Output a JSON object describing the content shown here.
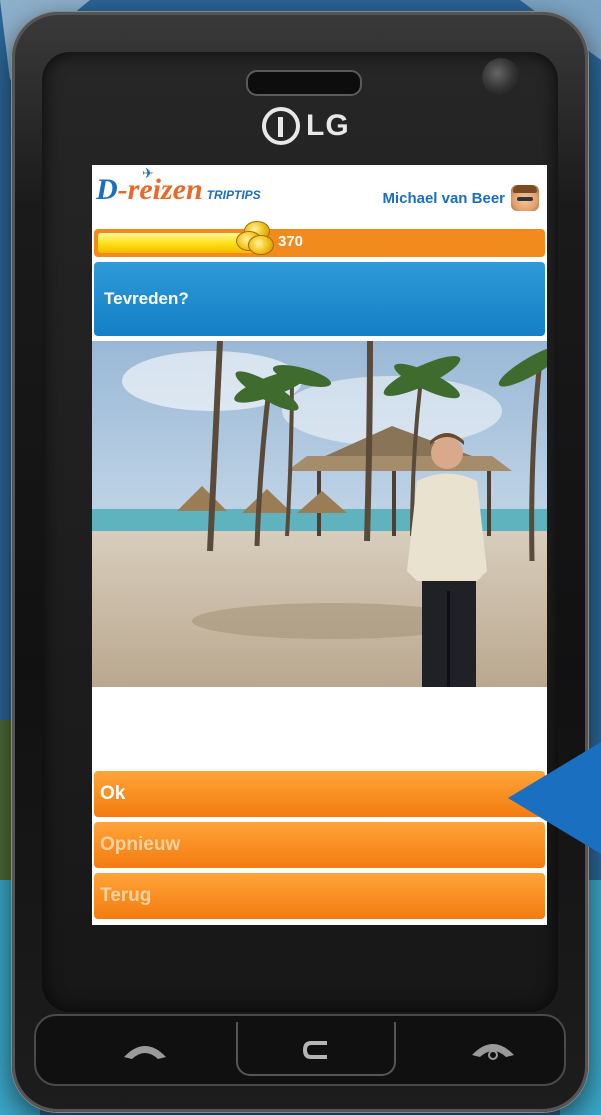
{
  "device": {
    "brand": "LG"
  },
  "app": {
    "logo": {
      "d": "D",
      "main": "-reizen",
      "sub": "TRIPTIPS"
    },
    "user": {
      "name": "Michael van Beer"
    },
    "progress": {
      "value": "370",
      "fraction": 0.38
    },
    "screen_title": "Tevreden?",
    "menu": {
      "ok": "Ok",
      "retry": "Opnieuw",
      "back": "Terug"
    }
  },
  "icons": {
    "call": "call-icon",
    "home": "home-back-icon",
    "end": "end-call-icon",
    "pointer": "pointer-arrow-icon"
  },
  "colors": {
    "orange": "#f47b0f",
    "blue": "#1380c6",
    "pointer": "#1a6fc0"
  }
}
